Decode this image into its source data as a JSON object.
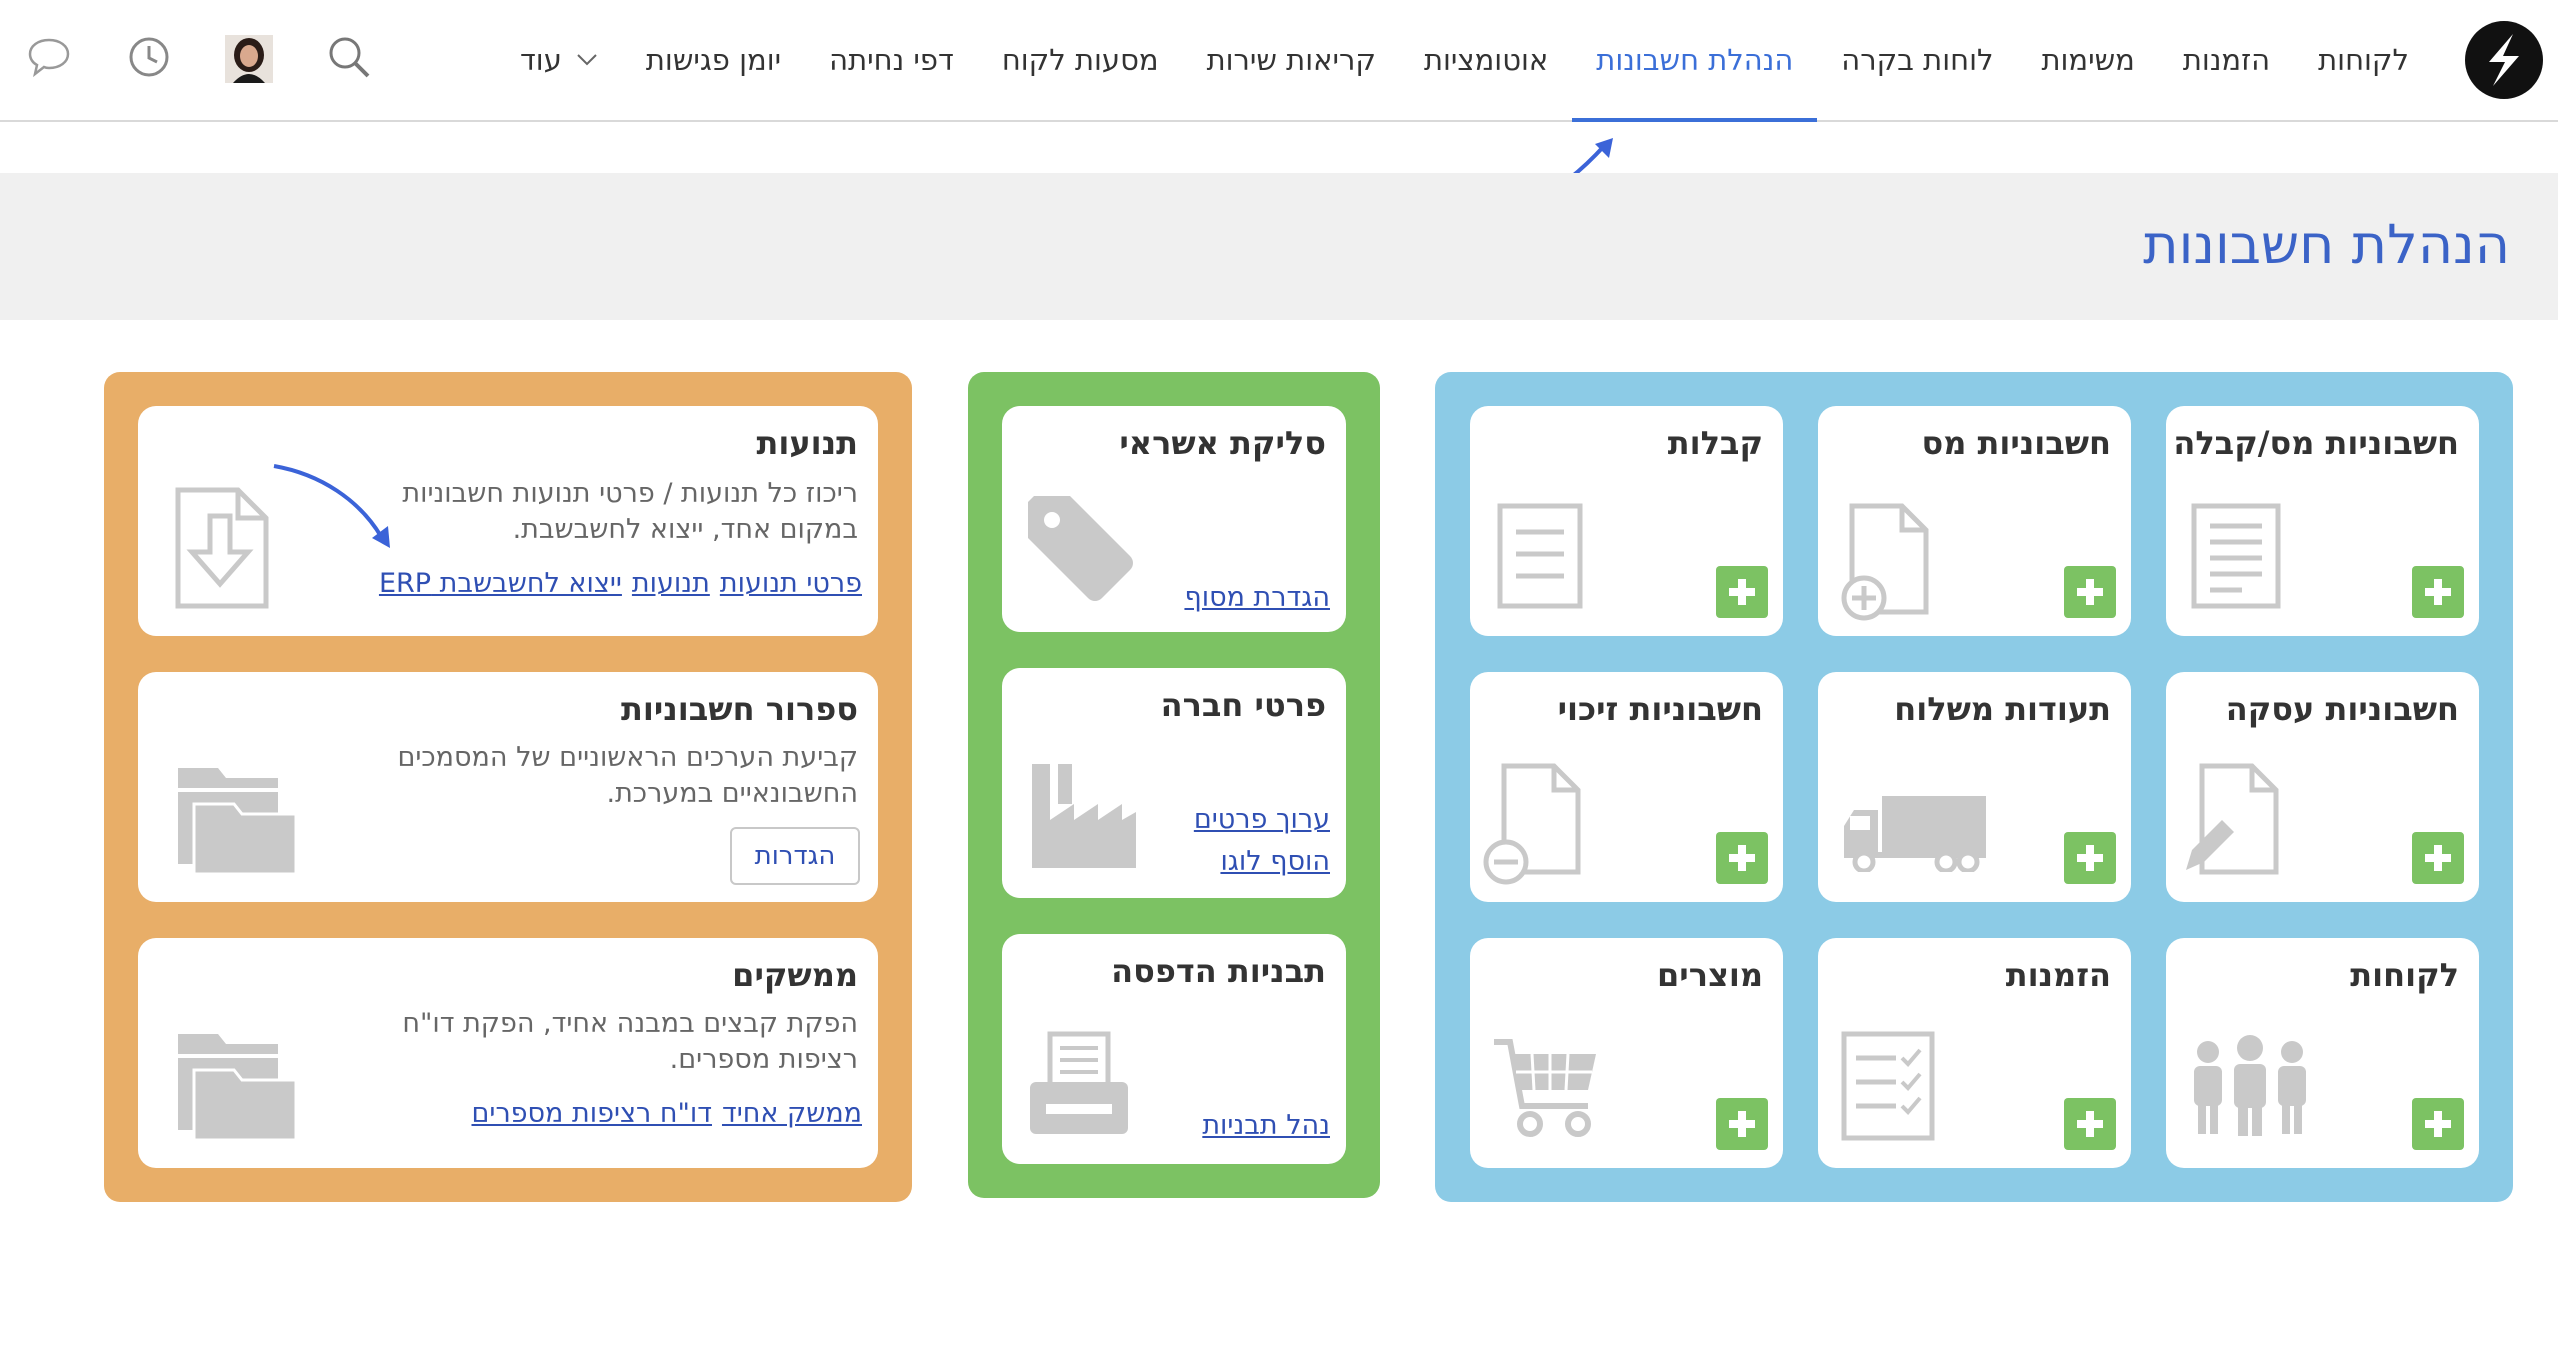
{
  "nav": {
    "items": [
      "לקוחות",
      "הזמנות",
      "משימות",
      "לוחות בקרה",
      "הנהלת חשבונות",
      "אוטומציות",
      "קריאות שירות",
      "מסעות לקוח",
      "דפי נחיתה",
      "יומן פגישות"
    ],
    "active_index": 4,
    "more_label": "עוד"
  },
  "page": {
    "title": "הנהלת חשבונות"
  },
  "colors": {
    "accent": "#3b6fd8",
    "blue_panel": "#8ccbe6",
    "green_panel": "#7cc263",
    "orange_panel": "#e8ae68",
    "plus": "#7cc263"
  },
  "documents": [
    {
      "title": "חשבוניות מס/קבלה",
      "icon": "receipt-icon"
    },
    {
      "title": "חשבוניות מס",
      "icon": "file-add-icon"
    },
    {
      "title": "קבלות",
      "icon": "document-lines-icon"
    },
    {
      "title": "חשבוניות עסקה",
      "icon": "file-edit-icon"
    },
    {
      "title": "תעודות משלוח",
      "icon": "truck-icon"
    },
    {
      "title": "חשבוניות זיכוי",
      "icon": "file-minus-icon"
    },
    {
      "title": "לקוחות",
      "icon": "people-icon"
    },
    {
      "title": "הזמנות",
      "icon": "checklist-icon"
    },
    {
      "title": "מוצרים",
      "icon": "cart-icon"
    }
  ],
  "green": {
    "credit": {
      "title": "סליקת אשראי",
      "link": "הגדרת מסוף"
    },
    "company": {
      "title": "פרטי חברה",
      "link1": "ערוך פרטים",
      "link2": "הוסף לוגו"
    },
    "print": {
      "title": "תבניות הדפסה",
      "link": "נהל תבניות"
    }
  },
  "orange": {
    "movements": {
      "title": "תנועות",
      "desc_line1": "ריכוז כל תנועות / פרטי תנועות חשבוניות",
      "desc_line2": "במקום אחד, ייצוא לחשבשבת.",
      "link1": "פרטי תנועות",
      "link2": "תנועות",
      "link3": "ייצוא לחשבשבת ERP"
    },
    "numbering": {
      "title": "ספרור חשבוניות",
      "desc_line1": "קביעת הערכים הראשוניים של המסמכים",
      "desc_line2": "החשבונאיים במערכת.",
      "button": "הגדרות"
    },
    "interfaces": {
      "title": "ממשקים",
      "desc_line1": "הפקת קבצים במבנה אחיד, הפקת דו\"ח",
      "desc_line2": "רציפות מספרים.",
      "link1": "ממשק אחיד",
      "link2": "דו\"ח רציפות מספרים"
    }
  }
}
